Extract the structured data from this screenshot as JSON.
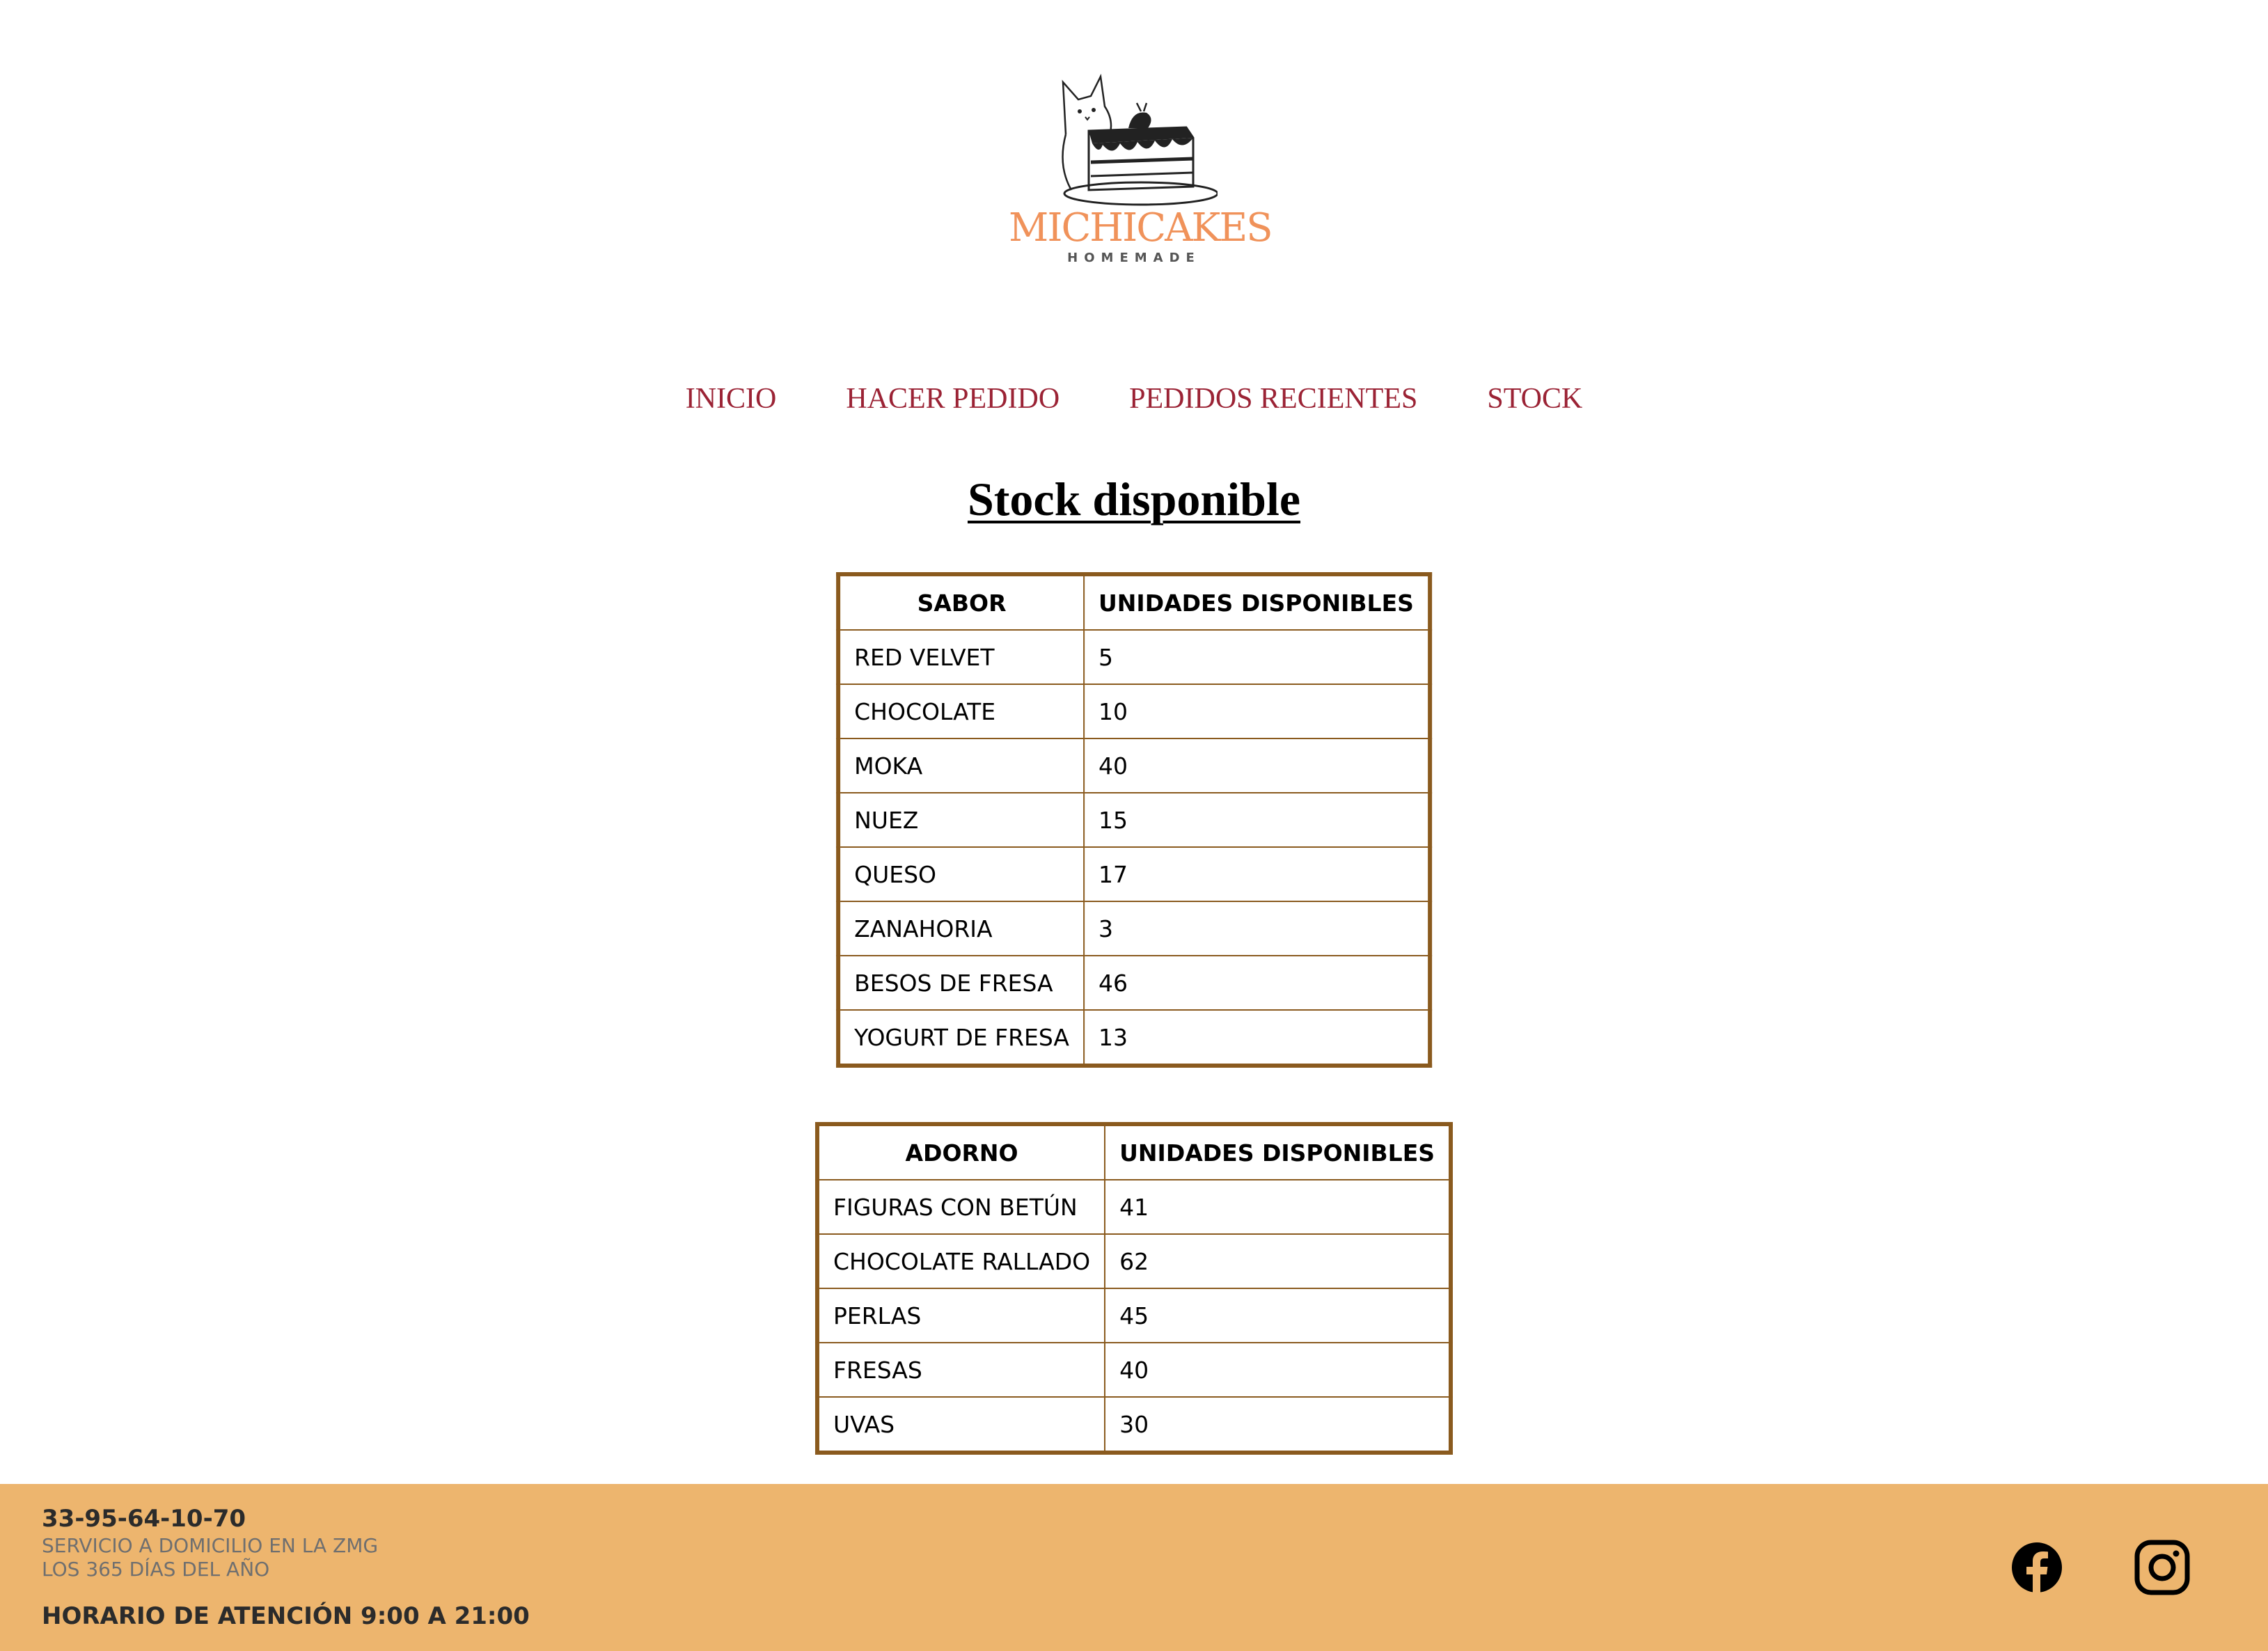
{
  "brand": {
    "name": "MICHICAKES",
    "tagline": "HOMEMADE"
  },
  "nav": {
    "items": [
      {
        "label": "INICIO"
      },
      {
        "label": "HACER PEDIDO"
      },
      {
        "label": "PEDIDOS RECIENTES"
      },
      {
        "label": "STOCK"
      }
    ]
  },
  "page": {
    "title": "Stock disponible"
  },
  "flavors_table": {
    "headers": [
      "SABOR",
      "UNIDADES DISPONIBLES"
    ],
    "rows": [
      [
        "RED VELVET",
        "5"
      ],
      [
        "CHOCOLATE",
        "10"
      ],
      [
        "MOKA",
        "40"
      ],
      [
        "NUEZ",
        "15"
      ],
      [
        "QUESO",
        "17"
      ],
      [
        "ZANAHORIA",
        "3"
      ],
      [
        "BESOS DE FRESA",
        "46"
      ],
      [
        "YOGURT DE FRESA",
        "13"
      ]
    ]
  },
  "toppings_table": {
    "headers": [
      "ADORNO",
      "UNIDADES DISPONIBLES"
    ],
    "rows": [
      [
        "FIGURAS CON BETÚN",
        "41"
      ],
      [
        "CHOCOLATE RALLADO",
        "62"
      ],
      [
        "PERLAS",
        "45"
      ],
      [
        "FRESAS",
        "40"
      ],
      [
        "UVAS",
        "30"
      ]
    ]
  },
  "footer": {
    "phone": "33-95-64-10-70",
    "line1": "SERVICIO A DOMICILIO EN LA ZMG",
    "line2": "LOS 365 DÍAS DEL AÑO",
    "hours": "HORARIO DE ATENCIÓN 9:00 A 21:00",
    "social": [
      "facebook-icon",
      "instagram-icon"
    ]
  },
  "colors": {
    "nav_link": "#9B2335",
    "brand": "#F0925A",
    "table_border": "#8A5A1E",
    "footer_bg": "#EDB56E"
  }
}
